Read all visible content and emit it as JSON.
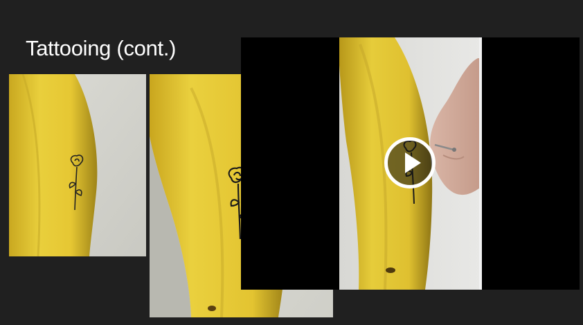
{
  "slide": {
    "title": "Tattooing (cont.)",
    "background_color": "#202020"
  },
  "images": [
    {
      "subject": "banana-with-rose-tattoo"
    },
    {
      "subject": "banana-with-rose-tattoo-closeup"
    }
  ],
  "video": {
    "subject": "hand-tattooing-banana-with-pin",
    "play_icon": "play-icon"
  }
}
